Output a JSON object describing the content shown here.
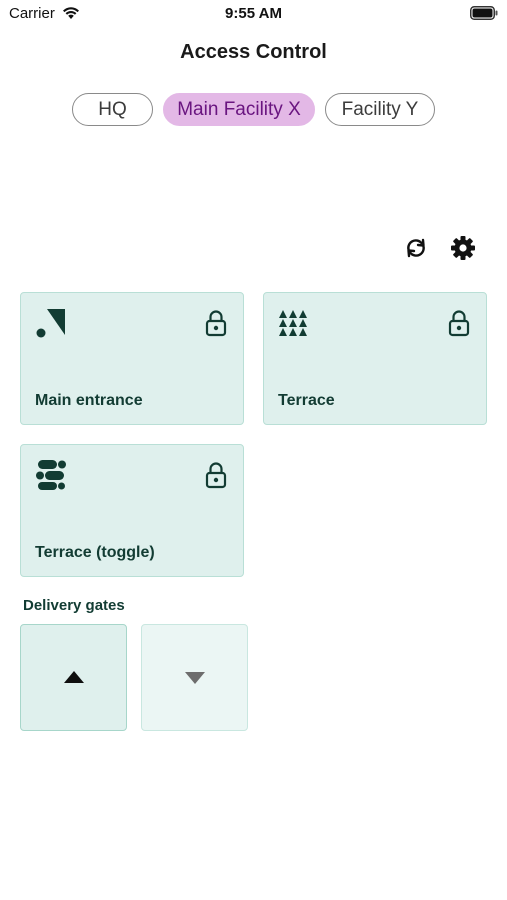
{
  "status_bar": {
    "carrier": "Carrier",
    "time": "9:55 AM",
    "wifi_icon": "wifi-icon",
    "battery_icon": "battery-icon"
  },
  "header": {
    "title": "Access Control"
  },
  "facility_tabs": [
    {
      "label": "HQ",
      "selected": false
    },
    {
      "label": "Main Facility X",
      "selected": true
    },
    {
      "label": "Facility Y",
      "selected": false
    }
  ],
  "toolbar": {
    "refresh_icon": "refresh-icon",
    "settings_icon": "gear-icon"
  },
  "doors": [
    {
      "label": "Main entrance",
      "icon": "main-entrance-logo-icon",
      "lock_icon": "lock-icon"
    },
    {
      "label": "Terrace",
      "icon": "terrace-logo-icon",
      "lock_icon": "lock-icon"
    },
    {
      "label": "Terrace (toggle)",
      "icon": "terrace-toggle-logo-icon",
      "lock_icon": "lock-icon"
    }
  ],
  "delivery_gates": {
    "section_label": "Delivery gates",
    "up_icon": "triangle-up-icon",
    "down_icon": "triangle-down-icon"
  },
  "colors": {
    "accent_selected_bg": "#e3b8e6",
    "accent_selected_text": "#6a1580",
    "card_bg": "#dff0ed",
    "card_border": "#b9dfd6",
    "dark_green": "#123c33"
  }
}
